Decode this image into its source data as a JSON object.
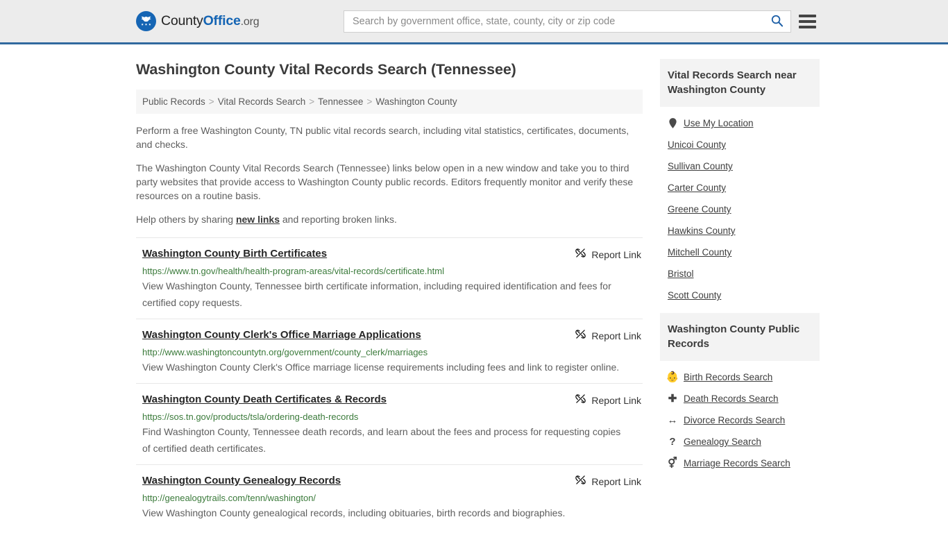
{
  "header": {
    "brand": {
      "county": "County",
      "office": "Office",
      "org": ".org",
      "icon": "eagle-seal-icon"
    },
    "search": {
      "placeholder": "Search by government office, state, county, city or zip code",
      "value": "",
      "search_icon": "search-icon"
    },
    "menu_icon": "hamburger-menu-icon",
    "accent_color": "#31699e"
  },
  "main": {
    "title": "Washington County Vital Records Search (Tennessee)",
    "breadcrumb": [
      {
        "label": "Public Records"
      },
      {
        "label": "Vital Records Search"
      },
      {
        "label": "Tennessee"
      },
      {
        "label": "Washington County"
      }
    ],
    "breadcrumb_separator": ">",
    "intro": [
      "Perform a free Washington County, TN public vital records search, including vital statistics, certificates, documents, and checks.",
      "The Washington County Vital Records Search (Tennessee) links below open in a new window and take you to third party websites that provide access to Washington County public records. Editors frequently monitor and verify these resources on a routine basis."
    ],
    "help_prefix": "Help others by sharing ",
    "help_link": "new links",
    "help_suffix": " and reporting broken links.",
    "report_label": "Report Link",
    "report_icon": "broken-link-icon",
    "results": [
      {
        "title": "Washington County Birth Certificates",
        "url": "https://www.tn.gov/health/health-program-areas/vital-records/certificate.html",
        "description": "View Washington County, Tennessee birth certificate information, including required identification and fees for certified copy requests."
      },
      {
        "title": "Washington County Clerk's Office Marriage Applications",
        "url": "http://www.washingtoncountytn.org/government/county_clerk/marriages",
        "description": "View Washington County Clerk's Office marriage license requirements including fees and link to register online."
      },
      {
        "title": "Washington County Death Certificates & Records",
        "url": "https://sos.tn.gov/products/tsla/ordering-death-records",
        "description": "Find Washington County, Tennessee death records, and learn about the fees and process for requesting copies of certified death certificates."
      },
      {
        "title": "Washington County Genealogy Records",
        "url": "http://genealogytrails.com/tenn/washington/",
        "description": "View Washington County genealogical records, including obituaries, birth records and biographies."
      }
    ]
  },
  "sidebar": {
    "nearby": {
      "heading": "Vital Records Search near Washington County",
      "items": [
        {
          "label": "Use My Location",
          "icon": "map-pin-icon"
        },
        {
          "label": "Unicoi County",
          "icon": ""
        },
        {
          "label": "Sullivan County",
          "icon": ""
        },
        {
          "label": "Carter County",
          "icon": ""
        },
        {
          "label": "Greene County",
          "icon": ""
        },
        {
          "label": "Hawkins County",
          "icon": ""
        },
        {
          "label": "Mitchell County",
          "icon": ""
        },
        {
          "label": "Bristol",
          "icon": ""
        },
        {
          "label": "Scott County",
          "icon": ""
        }
      ]
    },
    "public_records": {
      "heading": "Washington County Public Records",
      "items": [
        {
          "label": "Birth Records Search",
          "icon": "baby-icon",
          "glyph": "👶"
        },
        {
          "label": "Death Records Search",
          "icon": "cross-icon",
          "glyph": "✚"
        },
        {
          "label": "Divorce Records Search",
          "icon": "divorce-arrows-icon",
          "glyph": "↔"
        },
        {
          "label": "Genealogy Search",
          "icon": "question-mark-icon",
          "glyph": "?"
        },
        {
          "label": "Marriage Records Search",
          "icon": "marriage-symbol-icon",
          "glyph": "⚥"
        }
      ]
    }
  }
}
